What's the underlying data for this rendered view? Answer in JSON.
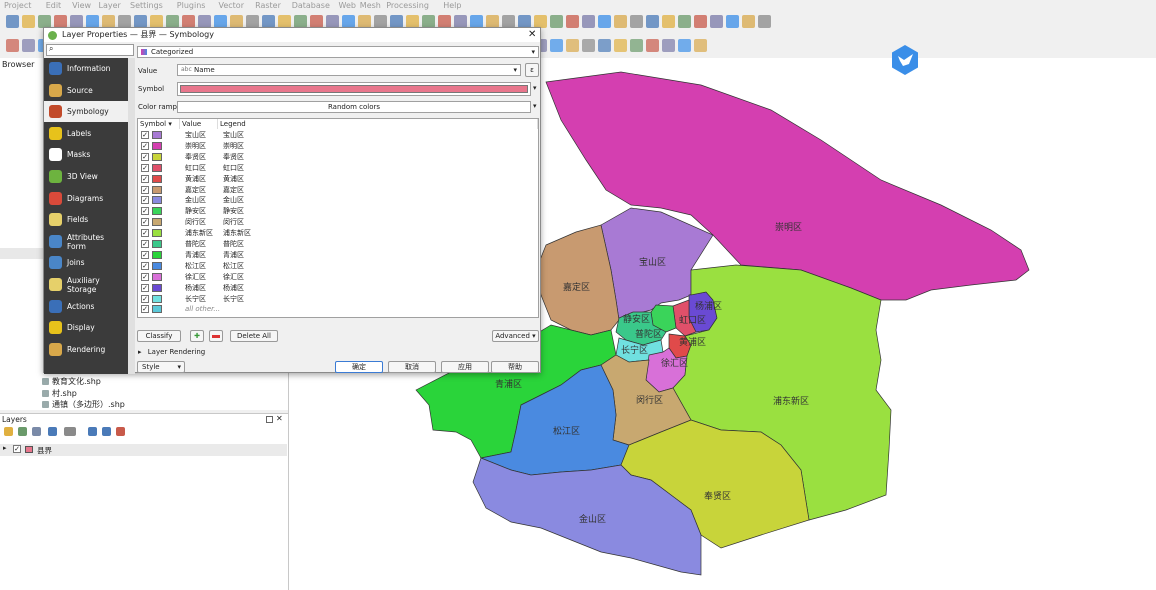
{
  "menu": [
    "Project",
    "Edit",
    "View",
    "Layer",
    "Settings",
    "Plugins",
    "Vector",
    "Raster",
    "Database",
    "Web",
    "Mesh",
    "Processing",
    "Help"
  ],
  "browser": {
    "title": "Browser",
    "files": [
      "教育文化.shp",
      "村.shp",
      "通镇（多边形）.shp"
    ]
  },
  "layers_panel": {
    "title": "Layers",
    "layer_name": "县界"
  },
  "dialog": {
    "title": "Layer Properties — 县界 — Symbology",
    "search_placeholder": "",
    "sidebar": [
      {
        "label": "Information",
        "icon": "info-icon",
        "color": "#3a6fb8"
      },
      {
        "label": "Source",
        "icon": "source-icon",
        "color": "#d8a84a"
      },
      {
        "label": "Symbology",
        "icon": "brush-icon",
        "color": "#c24a2a",
        "active": true
      },
      {
        "label": "Labels",
        "icon": "labels-icon",
        "color": "#e7c21b"
      },
      {
        "label": "Masks",
        "icon": "masks-icon",
        "color": "#ffffff"
      },
      {
        "label": "3D View",
        "icon": "cube-icon",
        "color": "#6db33f"
      },
      {
        "label": "Diagrams",
        "icon": "diagram-icon",
        "color": "#d94a3a"
      },
      {
        "label": "Fields",
        "icon": "fields-icon",
        "color": "#e6d06a"
      },
      {
        "label": "Attributes Form",
        "icon": "form-icon",
        "color": "#4a86c8"
      },
      {
        "label": "Joins",
        "icon": "joins-icon",
        "color": "#4a86c8"
      },
      {
        "label": "Auxiliary Storage",
        "icon": "storage-icon",
        "color": "#e6d06a"
      },
      {
        "label": "Actions",
        "icon": "actions-icon",
        "color": "#3a6fb8"
      },
      {
        "label": "Display",
        "icon": "display-icon",
        "color": "#e7c21b"
      },
      {
        "label": "Rendering",
        "icon": "rendering-icon",
        "color": "#d8a84a"
      }
    ],
    "renderer": "Categorized",
    "value_label": "Value",
    "value_field": "Name",
    "value_prefix": "abc",
    "symbol_label": "Symbol",
    "symbol_color": "#e8768c",
    "color_ramp_label": "Color ramp",
    "color_ramp_value": "Random colors",
    "table_headers": {
      "symbol": "Symbol",
      "value": "Value",
      "legend": "Legend"
    },
    "categories": [
      {
        "value": "宝山区",
        "legend": "宝山区",
        "color": "#a87ad4"
      },
      {
        "value": "崇明区",
        "legend": "崇明区",
        "color": "#d43fb0"
      },
      {
        "value": "奉贤区",
        "legend": "奉贤区",
        "color": "#c8d43a"
      },
      {
        "value": "虹口区",
        "legend": "虹口区",
        "color": "#e0506a"
      },
      {
        "value": "黄浦区",
        "legend": "黄浦区",
        "color": "#e04a4a"
      },
      {
        "value": "嘉定区",
        "legend": "嘉定区",
        "color": "#c89a70"
      },
      {
        "value": "金山区",
        "legend": "金山区",
        "color": "#8a8ae0"
      },
      {
        "value": "静安区",
        "legend": "静安区",
        "color": "#3ad45a"
      },
      {
        "value": "闵行区",
        "legend": "闵行区",
        "color": "#c8a870"
      },
      {
        "value": "浦东新区",
        "legend": "浦东新区",
        "color": "#9ae040"
      },
      {
        "value": "普陀区",
        "legend": "普陀区",
        "color": "#3ac88a"
      },
      {
        "value": "青浦区",
        "legend": "青浦区",
        "color": "#2ad43a"
      },
      {
        "value": "松江区",
        "legend": "松江区",
        "color": "#4a8ae0"
      },
      {
        "value": "徐汇区",
        "legend": "徐汇区",
        "color": "#d870d8"
      },
      {
        "value": "杨浦区",
        "legend": "杨浦区",
        "color": "#6a4ad4"
      },
      {
        "value": "长宁区",
        "legend": "长宁区",
        "color": "#70e0e0"
      },
      {
        "value": "all other...",
        "legend": "",
        "color": "#5ac8d8"
      }
    ],
    "buttons": {
      "classify": "Classify",
      "delete_all": "Delete All",
      "advanced": "Advanced",
      "layer_rendering": "Layer Rendering",
      "style": "Style",
      "ok": "确定",
      "cancel": "取消",
      "apply": "应用",
      "help": "帮助"
    }
  },
  "map": {
    "districts": [
      {
        "name": "崇明区",
        "color": "#d43fb0"
      },
      {
        "name": "宝山区",
        "color": "#a87ad4"
      },
      {
        "name": "嘉定区",
        "color": "#c89a70"
      },
      {
        "name": "杨浦区",
        "color": "#6a4ad4"
      },
      {
        "name": "虹口区",
        "color": "#e0506a"
      },
      {
        "name": "静安区",
        "color": "#3ad45a"
      },
      {
        "name": "普陀区",
        "color": "#3ac88a"
      },
      {
        "name": "黄浦区",
        "color": "#e04a4a"
      },
      {
        "name": "长宁区",
        "color": "#70e0e0"
      },
      {
        "name": "徐汇区",
        "color": "#d870d8"
      },
      {
        "name": "青浦区",
        "color": "#2ad43a"
      },
      {
        "name": "闵行区",
        "color": "#c8a870"
      },
      {
        "name": "浦东新区",
        "color": "#9ae040"
      },
      {
        "name": "松江区",
        "color": "#4a8ae0"
      },
      {
        "name": "奉贤区",
        "color": "#c8d43a"
      },
      {
        "name": "金山区",
        "color": "#8a8ae0"
      }
    ]
  }
}
